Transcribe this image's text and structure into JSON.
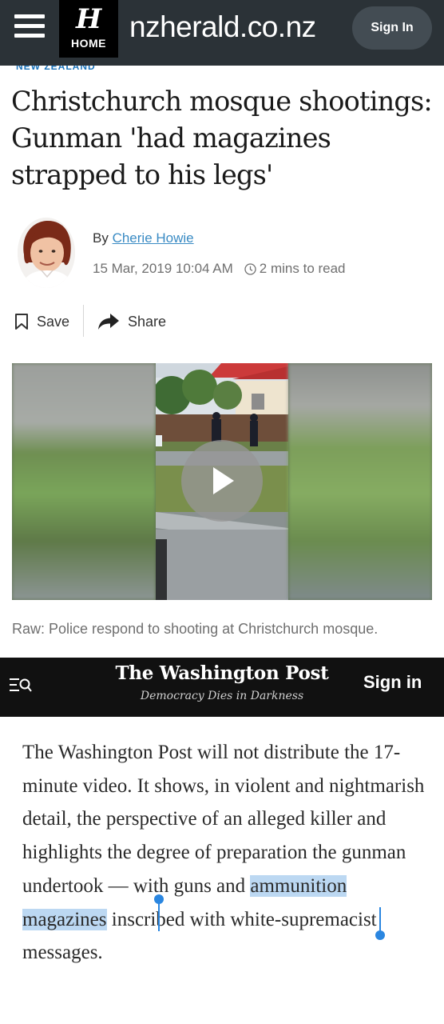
{
  "nzherald": {
    "logo_letter": "H",
    "logo_label": "HOME",
    "site_name": "nzherald.co.nz",
    "signin_label": "Sign In",
    "section_label": "NEW ZEALAND",
    "headline": "Christchurch mosque shootings: Gunman 'had magazines strapped to his legs'",
    "byline_prefix": "By",
    "author": "Cherie Howie",
    "date": "15 Mar, 2019 10:04 AM",
    "read_time": "2 mins to read",
    "save_label": "Save",
    "share_label": "Share",
    "video_caption": "Raw: Police respond to shooting at Christchurch mosque."
  },
  "washpost": {
    "logo": "The Washington Post",
    "tagline": "Democracy Dies in Darkness",
    "signin_label": "Sign in",
    "body_before": "The Washington Post will not distribute the 17-minute video. It shows, in violent and nightmarish detail, the perspective of an alleged killer and highlights the degree of preparation the gunman undertook — with guns and ",
    "body_highlight": "ammunition magazines",
    "body_after": " inscribed with white-supremacist messages."
  },
  "colors": {
    "nzh_header": "#2b3237",
    "link_blue": "#3a8bc4",
    "wp_header": "#111111",
    "selection": "#bcd8f2",
    "selection_handle": "#2a86e0"
  }
}
